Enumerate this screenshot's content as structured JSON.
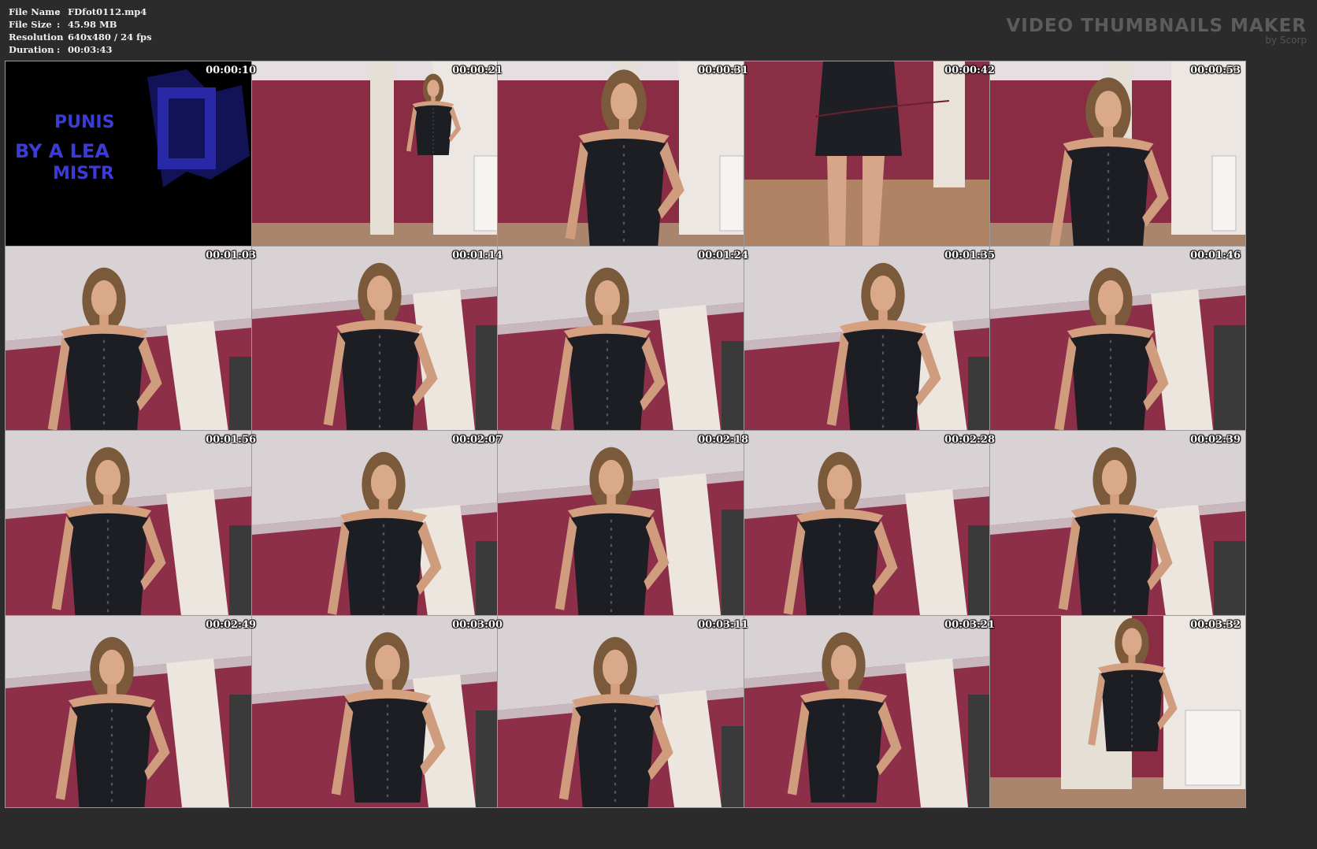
{
  "file_info": {
    "rows": [
      {
        "key": "File Name",
        "sep": ":",
        "value": "FDfot0112.mp4"
      },
      {
        "key": "File Size",
        "sep": ":",
        "value": "45.98 MB"
      },
      {
        "key": "Resolution",
        "sep": ":",
        "value": "640x480 / 24 fps"
      },
      {
        "key": "Duration",
        "sep": ":",
        "value": "00:03:43"
      }
    ]
  },
  "brand": {
    "title": "VIDEO THUMBNAILS MAKER",
    "subtitle": "by Scorp"
  },
  "title_frame": {
    "lines": [
      "PUNIS",
      "BY A LEA",
      "MISTR"
    ]
  },
  "thumbnails": [
    {
      "time": "00:00:10",
      "kind": "title"
    },
    {
      "time": "00:00:21",
      "kind": "room"
    },
    {
      "time": "00:00:31",
      "kind": "room"
    },
    {
      "time": "00:00:42",
      "kind": "floor"
    },
    {
      "time": "00:00:53",
      "kind": "room"
    },
    {
      "time": "00:01:03",
      "kind": "ceiling"
    },
    {
      "time": "00:01:14",
      "kind": "ceiling"
    },
    {
      "time": "00:01:24",
      "kind": "ceiling"
    },
    {
      "time": "00:01:35",
      "kind": "ceiling"
    },
    {
      "time": "00:01:46",
      "kind": "ceiling"
    },
    {
      "time": "00:01:56",
      "kind": "ceiling"
    },
    {
      "time": "00:02:07",
      "kind": "ceiling"
    },
    {
      "time": "00:02:18",
      "kind": "ceiling"
    },
    {
      "time": "00:02:28",
      "kind": "ceiling"
    },
    {
      "time": "00:02:39",
      "kind": "ceiling"
    },
    {
      "time": "00:02:49",
      "kind": "ceiling"
    },
    {
      "time": "00:03:00",
      "kind": "ceiling"
    },
    {
      "time": "00:03:11",
      "kind": "ceiling"
    },
    {
      "time": "00:03:21",
      "kind": "ceiling"
    },
    {
      "time": "00:03:32",
      "kind": "room"
    }
  ]
}
